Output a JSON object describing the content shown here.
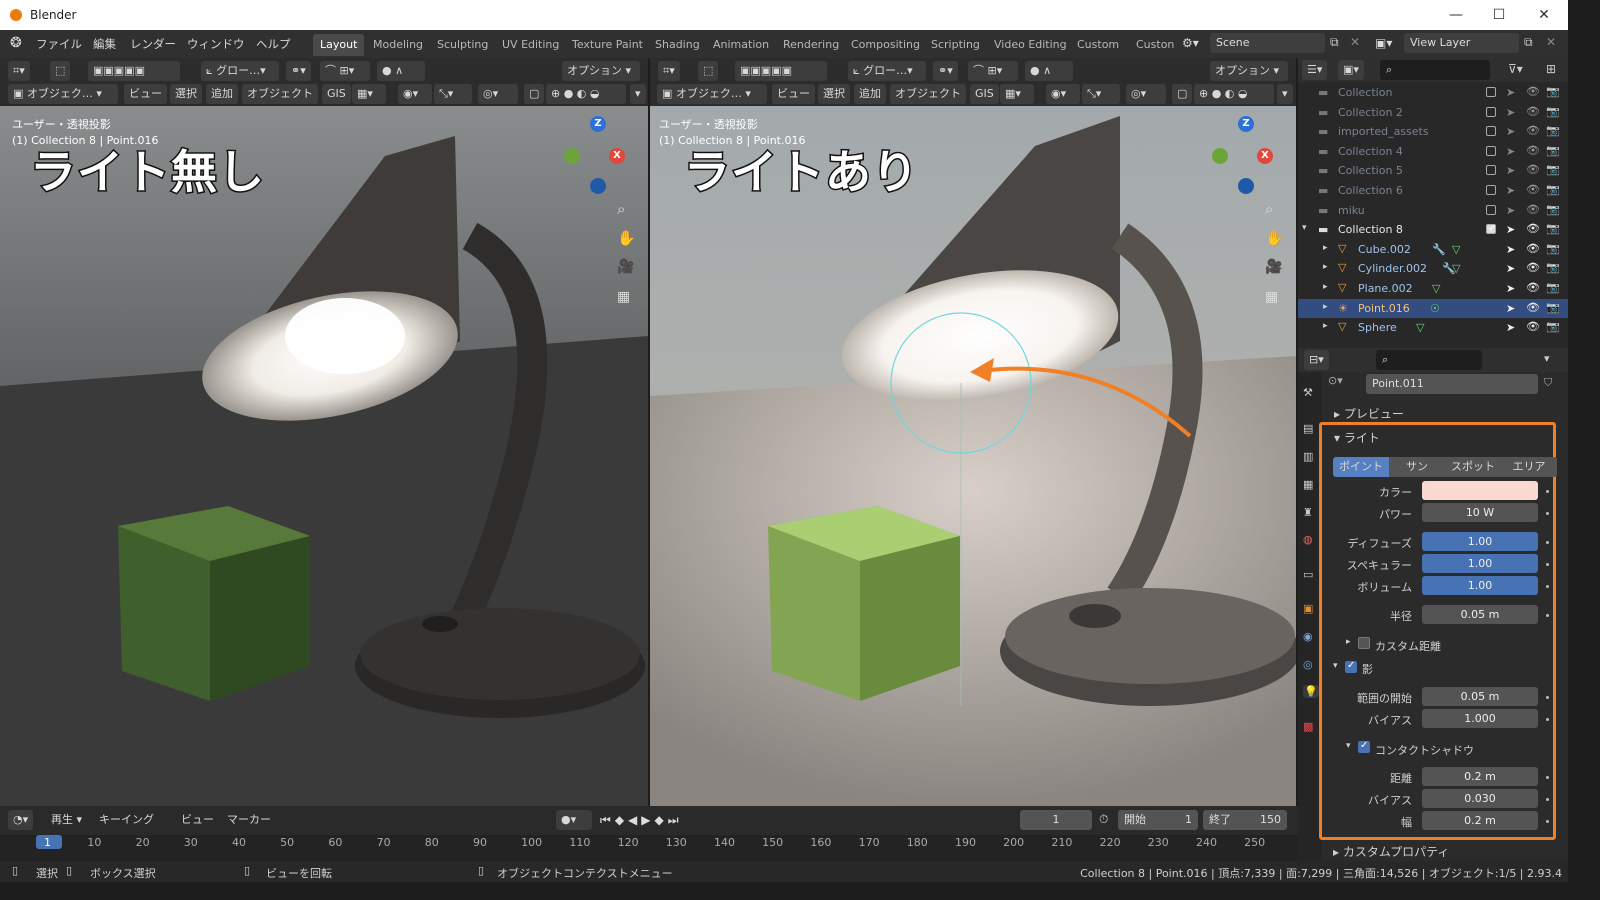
{
  "window": {
    "title": "Blender",
    "minimize": "—",
    "maximize": "☐",
    "close": "✕"
  },
  "menu": [
    "ファイル",
    "編集",
    "レンダー",
    "ウィンドウ",
    "ヘルプ"
  ],
  "workspaces": [
    "Layout",
    "Modeling",
    "Sculpting",
    "UV Editing",
    "Texture Paint",
    "Shading",
    "Animation",
    "Rendering",
    "Compositing",
    "Scripting",
    "Video Editing",
    "Custom",
    "Custon"
  ],
  "scene": {
    "name": "Scene",
    "view_layer": "View Layer"
  },
  "viewport_header": {
    "transform": "グロー…",
    "options": "オプション",
    "mode": "オブジェク…",
    "view": "ビュー",
    "select": "選択",
    "add": "追加",
    "object": "オブジェクト",
    "gis": "GIS"
  },
  "viewport_left": {
    "info1": "ユーザー・透視投影",
    "info2": "(1) Collection 8 | Point.016",
    "caption": "ライト無し"
  },
  "viewport_right": {
    "info1": "ユーザー・透視投影",
    "info2": "(1) Collection 8 | Point.016",
    "caption": "ライトあり"
  },
  "outliner": {
    "rows": [
      {
        "name": "Collection",
        "type": "collection"
      },
      {
        "name": "Collection 2",
        "type": "collection"
      },
      {
        "name": "imported_assets",
        "type": "collection"
      },
      {
        "name": "Collection 4",
        "type": "collection"
      },
      {
        "name": "Collection 5",
        "type": "collection"
      },
      {
        "name": "Collection 6",
        "type": "collection"
      },
      {
        "name": "miku",
        "type": "collection"
      },
      {
        "name": "Collection 8",
        "type": "collection-active"
      },
      {
        "name": "Cube.002",
        "type": "mesh"
      },
      {
        "name": "Cylinder.002",
        "type": "mesh"
      },
      {
        "name": "Plane.002",
        "type": "mesh"
      },
      {
        "name": "Point.016",
        "type": "light"
      },
      {
        "name": "Sphere",
        "type": "mesh"
      }
    ]
  },
  "properties": {
    "datablock": "Point.011",
    "preview": "プレビュー",
    "light_panel": "ライト",
    "light_types": [
      "ポイント",
      "サン",
      "スポット",
      "エリア"
    ],
    "color_label": "カラー",
    "color": "#fbd9cf",
    "power_label": "パワー",
    "power": "10 W",
    "diffuse_label": "ディフューズ",
    "diffuse": "1.00",
    "specular_label": "スペキュラー",
    "specular": "1.00",
    "volume_label": "ボリューム",
    "volume": "1.00",
    "radius_label": "半径",
    "radius": "0.05 m",
    "custom_distance": "カスタム距離",
    "shadow": "影",
    "clip_start_label": "範囲の開始",
    "clip_start": "0.05 m",
    "bias_label": "バイアス",
    "bias": "1.000",
    "contact_shadow": "コンタクトシャドウ",
    "distance_label": "距離",
    "distance": "0.2 m",
    "cs_bias_label": "バイアス",
    "cs_bias": "0.030",
    "thickness_label": "幅",
    "thickness": "0.2 m",
    "custom_props": "カスタムプロパティ"
  },
  "timeline": {
    "playback": "再生",
    "keying": "キーイング",
    "view": "ビュー",
    "marker": "マーカー",
    "current_frame": "1",
    "start_label": "開始",
    "start": "1",
    "end_label": "終了",
    "end": "150",
    "ticks": [
      "1",
      "10",
      "20",
      "30",
      "40",
      "50",
      "60",
      "70",
      "80",
      "90",
      "100",
      "110",
      "120",
      "130",
      "140",
      "150",
      "160",
      "170",
      "180",
      "190",
      "200",
      "210",
      "220",
      "230",
      "240",
      "250"
    ]
  },
  "status": {
    "select": "選択",
    "box_select": "ボックス選択",
    "rotate_view": "ビューを回転",
    "context_menu": "オブジェクトコンテクストメニュー",
    "info": "Collection 8 | Point.016 | 頂点:7,339 | 面:7,299 | 三角面:14,526 | オブジェクト:1/5 | 2.93.4"
  },
  "colors": {
    "accent": "#4772b3",
    "highlight": "#f07f26",
    "selected_row": "#334d80"
  }
}
